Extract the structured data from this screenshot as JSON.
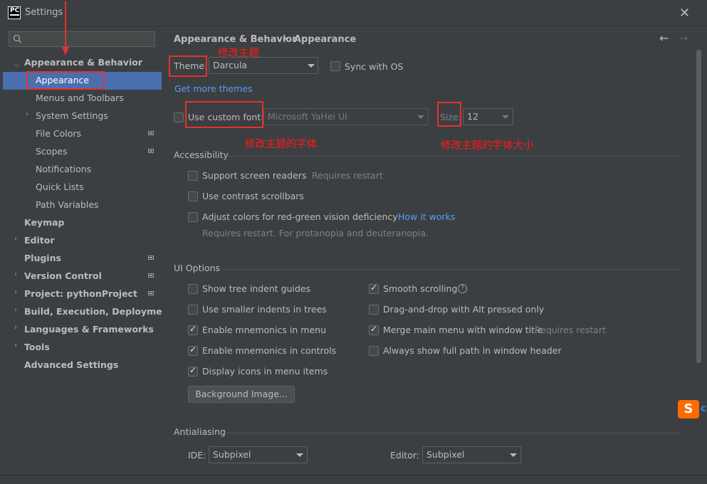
{
  "window": {
    "title": "Settings",
    "app_icon": "PC",
    "close_icon": "close-icon"
  },
  "search": {
    "placeholder": ""
  },
  "sidebar": {
    "items": [
      {
        "label": "Appearance & Behavior",
        "expanded": true,
        "bold": true
      },
      {
        "label": "Appearance",
        "selected": true
      },
      {
        "label": "Menus and Toolbars"
      },
      {
        "label": "System Settings",
        "expandable": true
      },
      {
        "label": "File Colors",
        "has_icon": true
      },
      {
        "label": "Scopes",
        "has_icon": true
      },
      {
        "label": "Notifications"
      },
      {
        "label": "Quick Lists"
      },
      {
        "label": "Path Variables"
      },
      {
        "label": "Keymap",
        "bold": true
      },
      {
        "label": "Editor",
        "bold": true,
        "expandable": true
      },
      {
        "label": "Plugins",
        "bold": true,
        "has_icon": true
      },
      {
        "label": "Version Control",
        "bold": true,
        "expandable": true,
        "has_icon": true
      },
      {
        "label": "Project: pythonProject",
        "bold": true,
        "expandable": true,
        "has_icon": true
      },
      {
        "label": "Build, Execution, Deployment",
        "bold": true,
        "expandable": true
      },
      {
        "label": "Languages & Frameworks",
        "bold": true,
        "expandable": true
      },
      {
        "label": "Tools",
        "bold": true,
        "expandable": true
      },
      {
        "label": "Advanced Settings",
        "bold": true
      }
    ]
  },
  "breadcrumb": {
    "parent": "Appearance & Behavior",
    "separator": "›",
    "current": "Appearance",
    "back_icon": "←",
    "forward_icon": "→"
  },
  "theme": {
    "label": "Theme:",
    "value": "Darcula",
    "sync_label": "Sync with OS",
    "sync_checked": false,
    "more_link": "Get more themes"
  },
  "font": {
    "custom_label": "Use custom font:",
    "custom_checked": false,
    "value": "Microsoft YaHei UI",
    "size_label": "Size:",
    "size_value": "12"
  },
  "accessibility": {
    "title": "Accessibility",
    "screen_readers": "Support screen readers",
    "screen_readers_hint": "Requires restart",
    "contrast": "Use contrast scrollbars",
    "red_green": "Adjust colors for red-green vision deficiency",
    "how_link": "How it works",
    "red_green_hint": "Requires restart. For protanopia and deuteranopia."
  },
  "ui_options": {
    "title": "UI Options",
    "left": [
      {
        "label": "Show tree indent guides",
        "checked": false
      },
      {
        "label": "Use smaller indents in trees",
        "checked": false
      },
      {
        "label": "Enable mnemonics in menu",
        "checked": true
      },
      {
        "label": "Enable mnemonics in controls",
        "checked": true
      },
      {
        "label": "Display icons in menu items",
        "checked": true
      }
    ],
    "right": [
      {
        "label": "Smooth scrolling",
        "checked": true
      },
      {
        "label": "Drag-and-drop with Alt pressed only",
        "checked": false
      },
      {
        "label": "Merge main menu with window title",
        "checked": true
      },
      {
        "label": "Always show full path in window header",
        "checked": false
      }
    ],
    "merge_hint": "Requires restart",
    "help_icon": "?",
    "background_button": "Background Image..."
  },
  "antialiasing": {
    "title": "Antialiasing",
    "ide_label": "IDE:",
    "ide_value": "Subpixel",
    "editor_label": "Editor:",
    "editor_value": "Subpixel"
  },
  "annotations": {
    "theme": "修改主题",
    "font": "修改主题的字体",
    "size": "修改主题的字体大小"
  },
  "colors": {
    "selection": "#4b6eaf",
    "link": "#589df6",
    "annotation": "#ff1a1a"
  }
}
